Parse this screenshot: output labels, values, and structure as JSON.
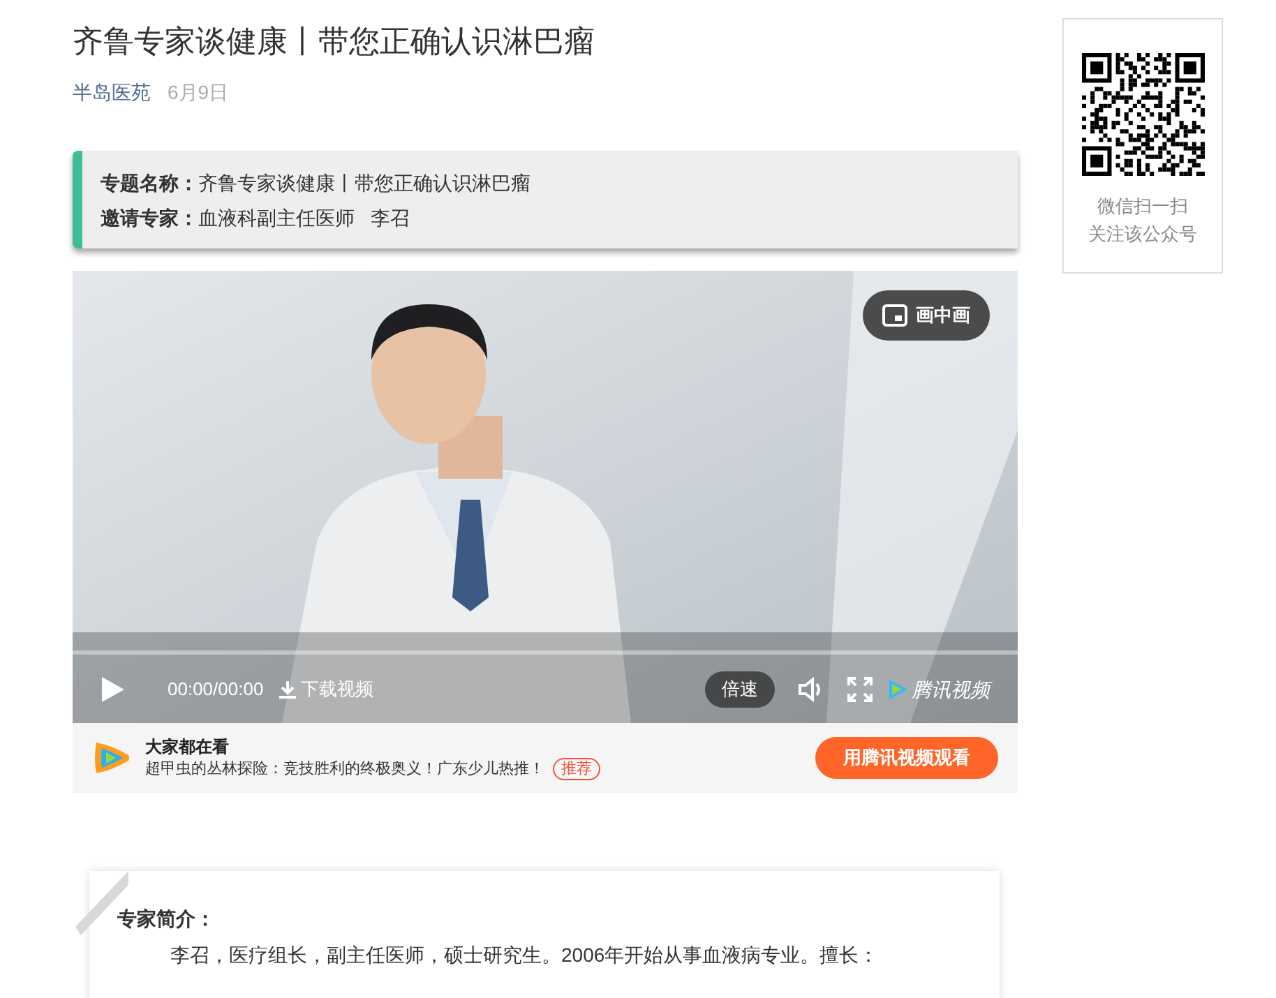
{
  "article": {
    "title": "齐鲁专家谈健康丨带您正确认识淋巴瘤",
    "source": "半岛医苑",
    "date": "6月9日"
  },
  "info_card": {
    "rows": [
      {
        "label": "专题名称：",
        "value": "齐鲁专家谈健康丨带您正确认识淋巴瘤"
      },
      {
        "label": "邀请专家：",
        "value": "血液科副主任医师   李召"
      }
    ]
  },
  "video": {
    "pip_label": "画中画",
    "time": "00:00/00:00",
    "download": "下载视频",
    "speed": "倍速",
    "brand": "腾讯视频"
  },
  "recommend": {
    "heading": "大家都在看",
    "text": "超甲虫的丛林探险：竞技胜利的终极奥义！广东少儿热推！",
    "tag": "推荐",
    "button": "用腾讯视频观看"
  },
  "intro": {
    "heading": "专家简介：",
    "text": "李召，医疗组长，副主任医师，硕士研究生。2006年开始从事血液病专业。擅长："
  },
  "qr": {
    "lines": [
      "微信扫一扫",
      "关注该公众号"
    ]
  }
}
